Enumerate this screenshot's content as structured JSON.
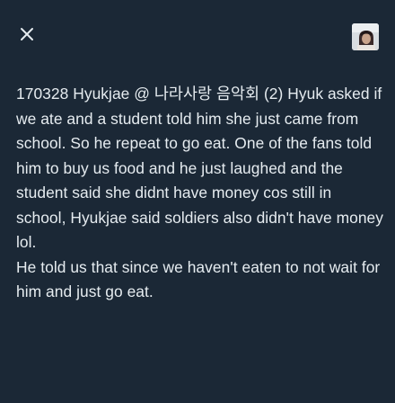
{
  "toolbar": {
    "close_icon": "close-icon",
    "avatar_icon": "avatar"
  },
  "tweet": {
    "paragraphs": [
      "170328 Hyukjae @ 나라사랑 음악회 (2) Hyuk asked if we ate and a student told him she just came from school. So he repeat to go eat. One of the fans told him to buy us food and he just laughed and the student said she didnt have money cos still in school, Hyukjae said soldiers also didn't have money lol.",
      "He told us that since we haven't eaten to not wait for him and just go eat."
    ]
  },
  "colors": {
    "background": "#1b2836",
    "text": "#e6ecf0"
  }
}
